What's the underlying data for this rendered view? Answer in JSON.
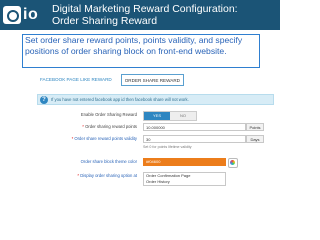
{
  "header": {
    "logo_text": "io",
    "title_line1": "Digital Marketing Reward Configuration:",
    "title_line2": "Order Sharing Reward"
  },
  "callout": {
    "text": "Set order share reward points, points validity, and specify positions of order sharing block on front-end website."
  },
  "tabs": [
    {
      "label": "FACEBOOK PAGE LIKE REWARD",
      "active": false
    },
    {
      "label": "ORDER SHARE REWARD",
      "active": true
    }
  ],
  "info": {
    "icon": "info-icon",
    "text": "If you have not entered facebook app id then facebook share will not work."
  },
  "form": {
    "enable": {
      "label": "Enable Order Sharing Reward",
      "yes": "YES",
      "no": "NO",
      "value": "YES"
    },
    "points": {
      "label": "Order sharing reward points",
      "value": "10.000000",
      "suffix": "Points"
    },
    "validity": {
      "label": "Order share reward points validity",
      "value": "30",
      "suffix": "Days",
      "hint": "Set 0 for points lifetime validity"
    },
    "theme": {
      "label": "Order share block theme color",
      "value": "#ff6600",
      "display": "#f04600"
    },
    "position": {
      "label": "Display order sharing option at",
      "options": [
        "Order Confirmation Page",
        "Order History"
      ]
    }
  },
  "colors": {
    "header_bg": "#1b5476",
    "accent": "#2e86c1",
    "theme_swatch": "#ec7d1b"
  }
}
